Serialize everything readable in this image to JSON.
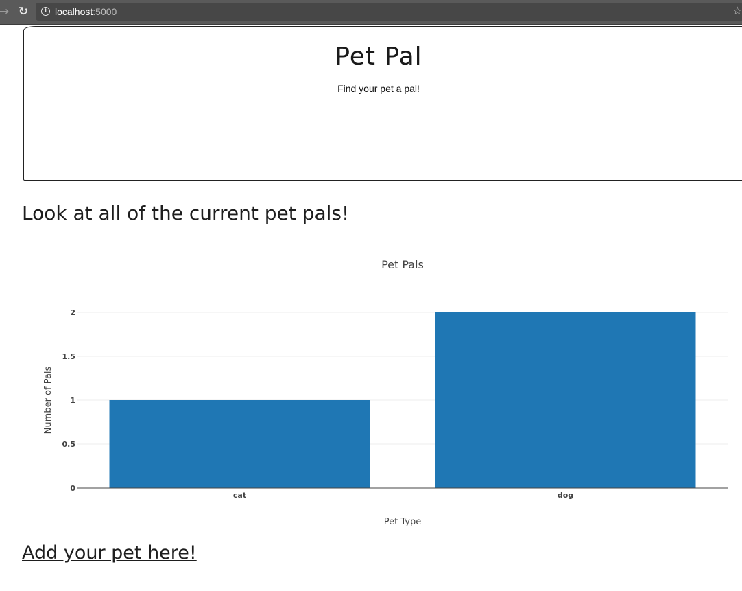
{
  "browser": {
    "url_host": "localhost",
    "url_port": ":5000",
    "forward_icon": "forward-arrow-icon",
    "reload_icon": "reload-icon",
    "info_icon": "info-icon",
    "bookmark_icon": "star-icon"
  },
  "header": {
    "title": "Pet Pal",
    "tagline": "Find your pet a pal!"
  },
  "main": {
    "section_heading": "Look at all of the current pet pals!",
    "add_link": "Add your pet here!"
  },
  "chart_data": {
    "type": "bar",
    "title": "Pet Pals",
    "xlabel": "Pet Type",
    "ylabel": "Number of Pals",
    "categories": [
      "cat",
      "dog"
    ],
    "values": [
      1,
      2
    ],
    "ylim": [
      0,
      2
    ],
    "yticks": [
      0,
      0.5,
      1,
      1.5,
      2
    ],
    "ytick_labels": [
      "0",
      "0.5",
      "1",
      "1.5",
      "2"
    ],
    "bar_color": "#1f77b4",
    "grid": true
  }
}
